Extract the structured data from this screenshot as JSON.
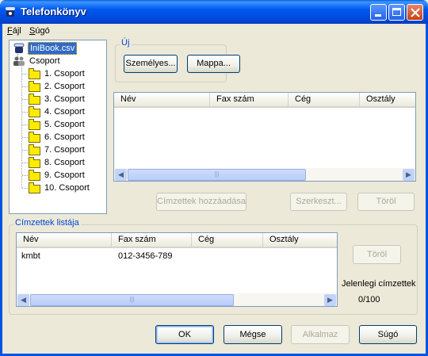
{
  "window": {
    "title": "Telefonkönyv"
  },
  "menu": {
    "file": "Fájl",
    "file_key": "F",
    "help": "Súgó",
    "help_key": "S"
  },
  "tree": {
    "root": "IniBook.csv",
    "group_root": "Csoport",
    "groups": [
      "1. Csoport",
      "2. Csoport",
      "3. Csoport",
      "4. Csoport",
      "5. Csoport",
      "6. Csoport",
      "7. Csoport",
      "8. Csoport",
      "9. Csoport",
      "10. Csoport"
    ]
  },
  "new_group": {
    "label": "Új",
    "personal_button": "Személyes...",
    "folder_button": "Mappa..."
  },
  "address_list": {
    "columns": [
      "Név",
      "Fax szám",
      "Cég",
      "Osztály"
    ],
    "rows": []
  },
  "actions": {
    "add_recipients": "Címzettek hozzáadása",
    "edit": "Szerkeszt...",
    "delete": "Töröl"
  },
  "recipients": {
    "label": "Címzettek listája",
    "columns": [
      "Név",
      "Fax szám",
      "Cég",
      "Osztály"
    ],
    "rows": [
      {
        "name": "kmbt",
        "fax": "012-3456-789",
        "company": "",
        "dept": ""
      }
    ],
    "delete_button": "Töröl",
    "current_label": "Jelenlegi címzettek",
    "current_count": "0/100"
  },
  "footer": {
    "ok": "OK",
    "cancel": "Mégse",
    "apply": "Alkalmaz",
    "help": "Súgó"
  }
}
